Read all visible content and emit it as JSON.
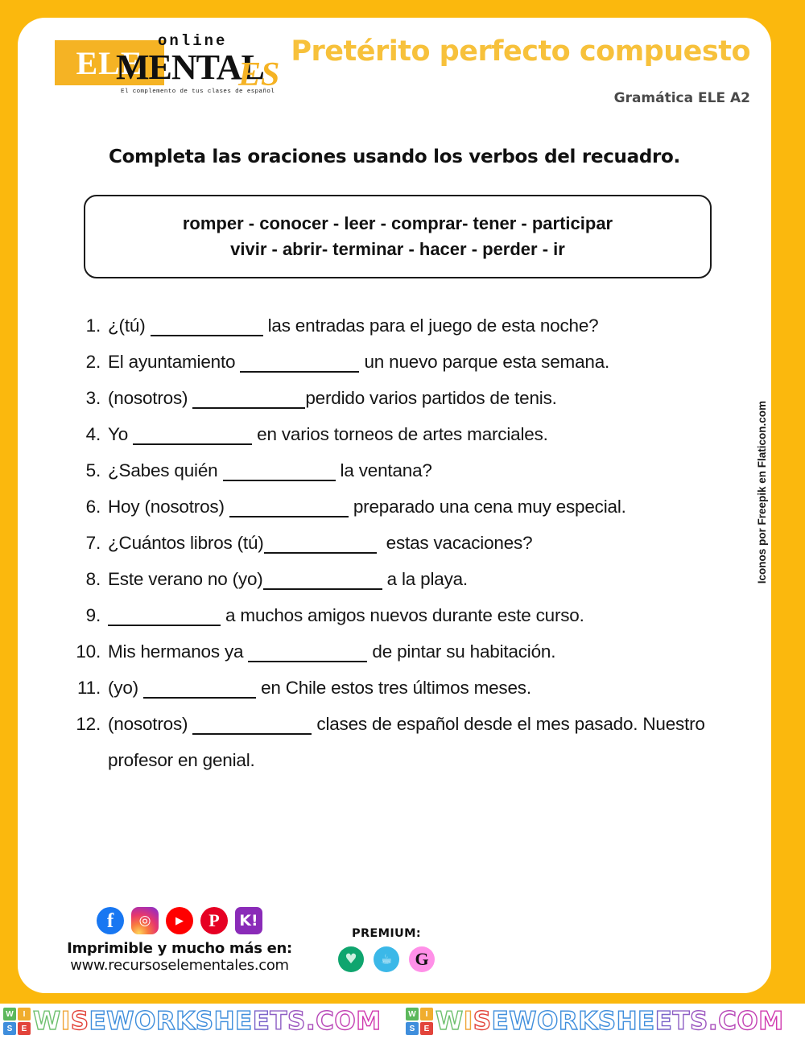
{
  "header": {
    "logo": {
      "ele": "ELE",
      "online": "online",
      "mental": "MENTAL",
      "es": "ES",
      "tagline": "El complemento de tus clases de español"
    },
    "title": "Pretérito perfecto compuesto",
    "subtitle": "Gramática ELE A2",
    "accent_color": "#F7C13B",
    "border_color": "#FBB80D"
  },
  "instruction": "Completa las oraciones usando los verbos del recuadro.",
  "verb_box": {
    "line1": "romper - conocer - leer -  comprar- tener - participar",
    "line2": "vivir - abrir- terminar - hacer - perder - ir",
    "verbs": [
      "romper",
      "conocer",
      "leer",
      "comprar",
      "tener",
      "participar",
      "vivir",
      "abrir",
      "terminar",
      "hacer",
      "perder",
      "ir"
    ]
  },
  "exercises": [
    {
      "num": "1.",
      "before": "¿(tú) ",
      "after": " las entradas para el juego de esta noche?"
    },
    {
      "num": "2.",
      "before": "El ayuntamiento ",
      "after": " un nuevo parque esta semana."
    },
    {
      "num": "3.",
      "before": "(nosotros) ",
      "after": "perdido varios partidos de tenis."
    },
    {
      "num": "4.",
      "before": "Yo ",
      "after": " en varios torneos de artes marciales."
    },
    {
      "num": "5.",
      "before": "¿Sabes quién ",
      "after": " la ventana?"
    },
    {
      "num": "6.",
      "before": "Hoy (nosotros) ",
      "after": " preparado una cena muy especial."
    },
    {
      "num": "7.",
      "before": "¿Cuántos libros (tú)",
      "after": "  estas vacaciones?"
    },
    {
      "num": "8.",
      "before": "Este verano no (yo)",
      "after": " a la playa."
    },
    {
      "num": "9.",
      "before": "",
      "after": " a muchos amigos nuevos durante este curso."
    },
    {
      "num": "10.",
      "before": "Mis hermanos ya ",
      "after": " de pintar su habitación."
    },
    {
      "num": "11.",
      "before": "(yo) ",
      "after": " en Chile estos tres últimos meses."
    },
    {
      "num": "12.",
      "before": "(nosotros) ",
      "after": " clases de español desde el mes pasado. Nuestro profesor en genial."
    }
  ],
  "side_credit": "Iconos por Freepik  en Flaticon.com",
  "footer": {
    "social": [
      {
        "name": "facebook",
        "glyph": "f"
      },
      {
        "name": "instagram",
        "glyph": "◎"
      },
      {
        "name": "youtube",
        "glyph": "▶"
      },
      {
        "name": "pinterest",
        "glyph": "P"
      },
      {
        "name": "kahoot",
        "glyph": "K!"
      }
    ],
    "line1": "Imprimible y mucho más en:",
    "line2": "www.recursoselementales.com",
    "premium_label": "PREMIUM:",
    "premium": [
      {
        "name": "teachers-pay-teachers",
        "glyph": "♥"
      },
      {
        "name": "ko-fi",
        "glyph": "☕"
      },
      {
        "name": "gumroad",
        "glyph": "G"
      }
    ]
  },
  "watermark": {
    "logo_cells": [
      "W",
      "I",
      "S",
      "E"
    ],
    "text": "WISEWORKSHEETS.COM",
    "repeat": 2
  }
}
